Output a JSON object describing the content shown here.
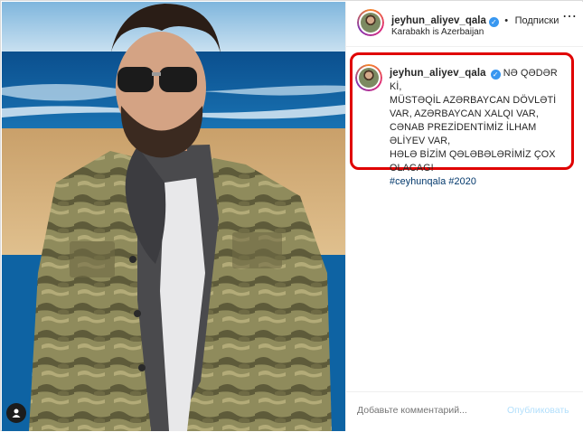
{
  "post": {
    "username": "jeyhun_aliyev_qala",
    "verified_icon": "verified-badge-icon",
    "follow_separator": "•",
    "follow_label": "Подписки",
    "location": "Karabakh is Azerbaijan",
    "more_icon": "more-options-icon"
  },
  "caption": {
    "username": "jeyhun_aliyev_qala",
    "lines": [
      "NƏ QƏDƏR Kİ,",
      "MÜSTƏQİL AZƏRBAYCAN DÖVLƏTİ",
      "VAR, AZƏRBAYCAN XALQI VAR,",
      "CƏNAB PREZİDENTİMİZ İLHAM",
      "ƏLİYEV VAR,",
      "HƏLƏ BİZİM QƏLƏBƏLƏRİMİZ ÇOX",
      "OLACAG!"
    ],
    "hashtags": "#ceyhunqala #2020"
  },
  "comment": {
    "placeholder": "Добавьте комментарий...",
    "publish_label": "Опубликовать"
  },
  "colors": {
    "highlight_border": "#e00000",
    "verified_blue": "#3897f0",
    "hashtag": "#00376b",
    "publish_disabled": "#b2dffc"
  }
}
